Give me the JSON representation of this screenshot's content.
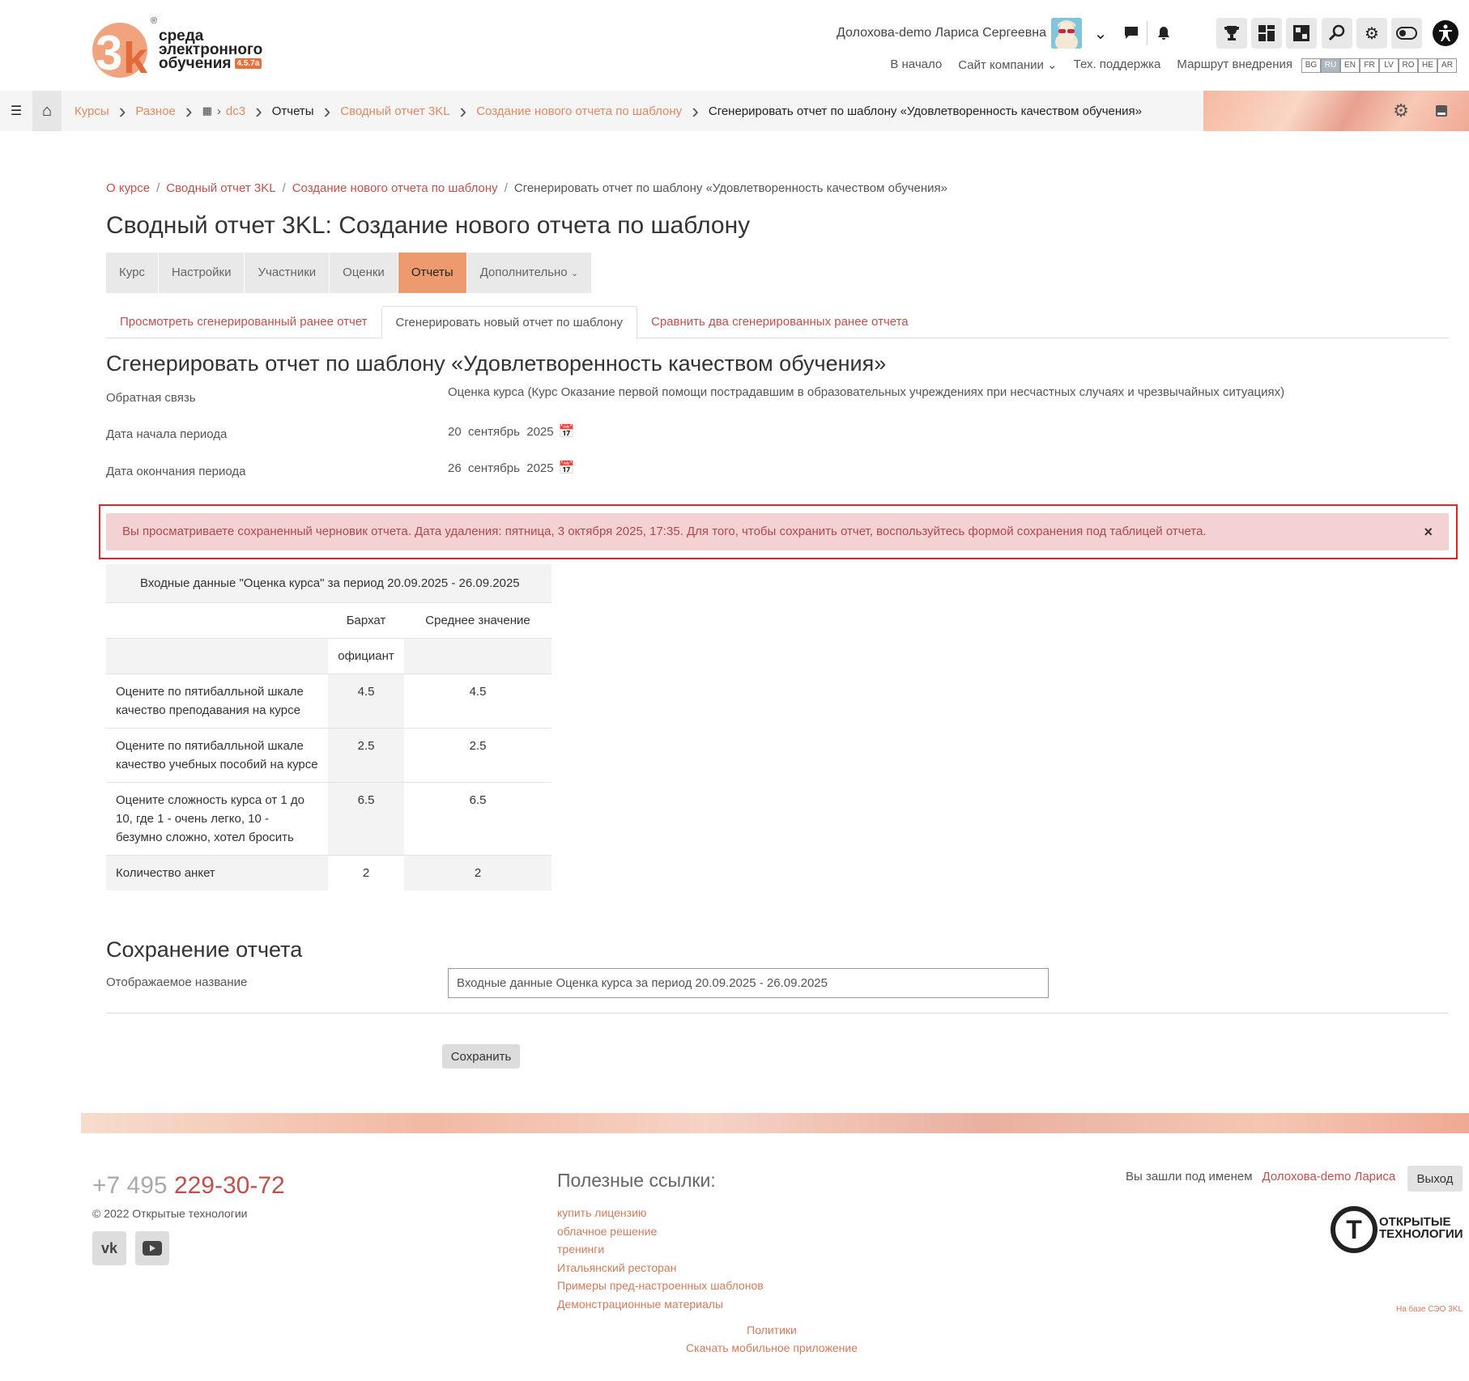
{
  "header": {
    "logo_text_1": "среда",
    "logo_text_2": "электронного",
    "logo_text_3": "обучения",
    "logo_version": "4.5.7a",
    "user_name": "Долохова-demo Лариса Сергеевна",
    "top_links": [
      "В начало",
      "Сайт компании",
      "Тех. поддержка",
      "Маршрут внедрения"
    ],
    "languages": [
      "BG",
      "RU",
      "EN",
      "FR",
      "LV",
      "RO",
      "HE",
      "AR"
    ],
    "active_language": "RU",
    "icons": [
      "chevron-down-icon",
      "chat-icon",
      "bell-icon",
      "trophy-icon",
      "dashboard-icon",
      "puzzle-icon",
      "search-icon",
      "gear-icon",
      "toggle-icon",
      "accessibility-icon"
    ]
  },
  "navbar": {
    "crumbs": [
      "Курсы",
      "Разное",
      "dc3",
      "Отчеты",
      "Сводный отчет 3KL",
      "Создание нового отчета по шаблону",
      "Сгенерировать отчет по шаблону «Удовлетворенность качеством обучения»"
    ]
  },
  "page": {
    "crumbs": [
      "О курсе",
      "Сводный отчет 3KL",
      "Создание нового отчета по шаблону",
      "Сгенерировать отчет по шаблону «Удовлетворенность качеством обучения»"
    ],
    "title": "Сводный отчет 3KL: Создание нового отчета по шаблону",
    "main_tabs": [
      "Курс",
      "Настройки",
      "Участники",
      "Оценки",
      "Отчеты",
      "Дополнительно"
    ],
    "active_main_tab": "Отчеты",
    "sub_tabs": [
      "Просмотреть сгенерированный ранее отчет",
      "Сгенерировать новый отчет по шаблону",
      "Сравнить два сгенерированных ранее отчета"
    ],
    "active_sub_tab": "Сгенерировать новый отчет по шаблону",
    "section_title": "Сгенерировать отчет по шаблону «Удовлетворенность качеством обучения»",
    "fields": {
      "feedback_label": "Обратная связь",
      "feedback_value": "Оценка курса (Курс Оказание первой помощи пострадавшим в образовательных учреждениях при несчастных случаях и чрезвычайных ситуациях)",
      "start_label": "Дата начала периода",
      "start_value": "20  сентябрь  2025",
      "end_label": "Дата окончания периода",
      "end_value": "26  сентябрь  2025"
    },
    "alert": "Вы просматриваете сохраненный черновик отчета. Дата удаления: пятница, 3 октября 2025, 17:35. Для того, чтобы сохранить отчет, воспользуйтесь формой сохранения под таблицей отчета.",
    "report": {
      "caption": "Входные данные \"Оценка курса\" за период 20.09.2025 - 26.09.2025",
      "col_headers": [
        "",
        "Бархат",
        "Среднее значение"
      ],
      "sub_header": [
        "",
        "официант",
        ""
      ],
      "rows": [
        [
          "Оцените по пятибалльной шкале качество преподавания на курсе",
          "4.5",
          "4.5"
        ],
        [
          "Оцените по пятибалльной шкале качество учебных пособий на курсе",
          "2.5",
          "2.5"
        ],
        [
          "Оцените сложность курса от 1 до 10, где 1 - очень легко, 10 - безумно сложно, хотел бросить",
          "6.5",
          "6.5"
        ],
        [
          "Количество анкет",
          "2",
          "2"
        ]
      ]
    },
    "save": {
      "title": "Сохранение отчета",
      "label": "Отображаемое название",
      "value": "Входные данные Оценка курса за период 20.09.2025 - 26.09.2025",
      "button": "Сохранить"
    }
  },
  "footer": {
    "phone_prefix": "+7 495",
    "phone_main": "229-30-72",
    "copyright": "© 2022  Открытые технологии",
    "social": [
      "vk-icon",
      "youtube-icon"
    ],
    "links_title": "Полезные ссылки:",
    "useful_links": [
      "купить лицензию",
      "облачное решение",
      "тренинги",
      "Итальянский ресторан",
      "Примеры пред-настроенных шаблонов",
      "Демонстрационные материалы"
    ],
    "bottom_links": [
      "Политики",
      "Скачать мобильное приложение"
    ],
    "logged_in_text": "Вы зашли под именем",
    "logged_in_name": "Долохова-demo Лариса",
    "logout": "Выход",
    "partner_logo_text_1": "ОТКРЫТЫЕ",
    "partner_logo_text_2": "ТЕХНОЛОГИИ",
    "based_on": "На базе СЭО 3KL"
  }
}
